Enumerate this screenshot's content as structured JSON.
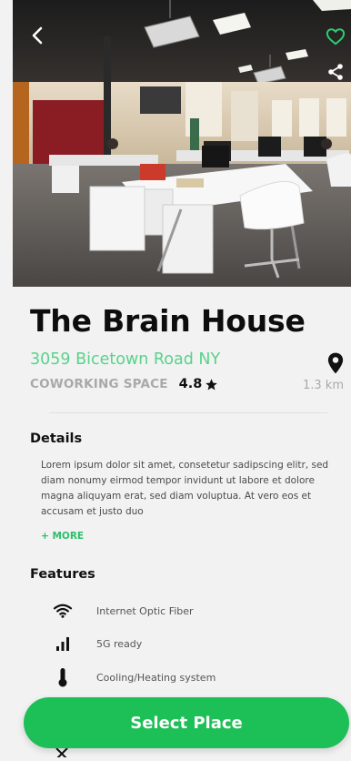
{
  "place": {
    "name": "The Brain House",
    "address": "3059 Bicetown Road NY",
    "category": "COWORKING SPACE",
    "rating": "4.8",
    "distance": "1.3 km"
  },
  "details": {
    "heading": "Details",
    "text": "Lorem ipsum dolor sit amet, consetetur sadipscing elitr, sed diam nonumy eirmod tempor invidunt ut labore et dolore magna aliquyam erat, sed diam voluptua. At vero eos et accusam et justo duo",
    "more_label": "+ MORE"
  },
  "features": {
    "heading": "Features",
    "items": [
      {
        "icon": "wifi-icon",
        "label": "Internet Optic Fiber"
      },
      {
        "icon": "signal-bars-icon",
        "label": "5G ready"
      },
      {
        "icon": "thermometer-icon",
        "label": "Cooling/Heating system"
      }
    ]
  },
  "actions": {
    "select_label": "Select Place"
  },
  "colors": {
    "accent_green": "#1dbf57",
    "address_green": "#58d38b",
    "heart_green": "#2ecc71"
  }
}
